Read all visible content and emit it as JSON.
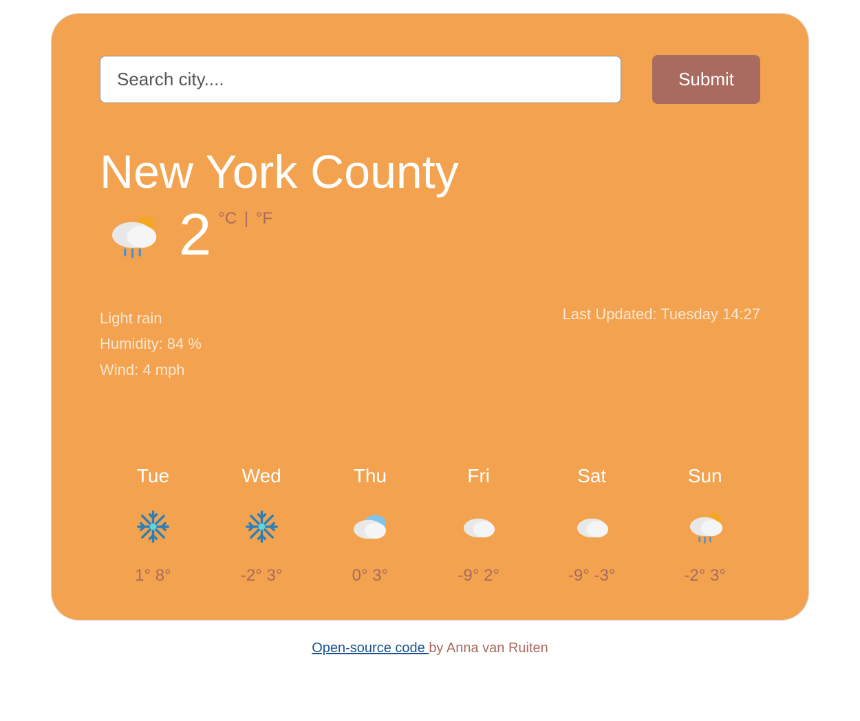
{
  "search": {
    "placeholder": "Search city....",
    "submit_label": "Submit"
  },
  "current": {
    "city": "New York County",
    "temperature": "2",
    "unit_c": "°C",
    "unit_separator": " | ",
    "unit_f": "°F",
    "description": "Light rain",
    "humidity_label": "Humidity: 84 %",
    "wind_label": "Wind: 4 mph",
    "last_updated": "Last Updated: Tuesday 14:27",
    "icon": "rain-sun"
  },
  "forecast": [
    {
      "day": "Tue",
      "icon": "snow",
      "low": "1°",
      "high": "8°"
    },
    {
      "day": "Wed",
      "icon": "snow",
      "low": "-2°",
      "high": "3°"
    },
    {
      "day": "Thu",
      "icon": "cloudy",
      "low": "0°",
      "high": "3°"
    },
    {
      "day": "Fri",
      "icon": "cloud",
      "low": "-9°",
      "high": "2°"
    },
    {
      "day": "Sat",
      "icon": "cloud",
      "low": "-9°",
      "high": "-3°"
    },
    {
      "day": "Sun",
      "icon": "rain-sun",
      "low": "-2°",
      "high": "3°"
    }
  ],
  "footer": {
    "link_text": "Open-source code ",
    "author_text": "by Anna van Ruiten"
  }
}
